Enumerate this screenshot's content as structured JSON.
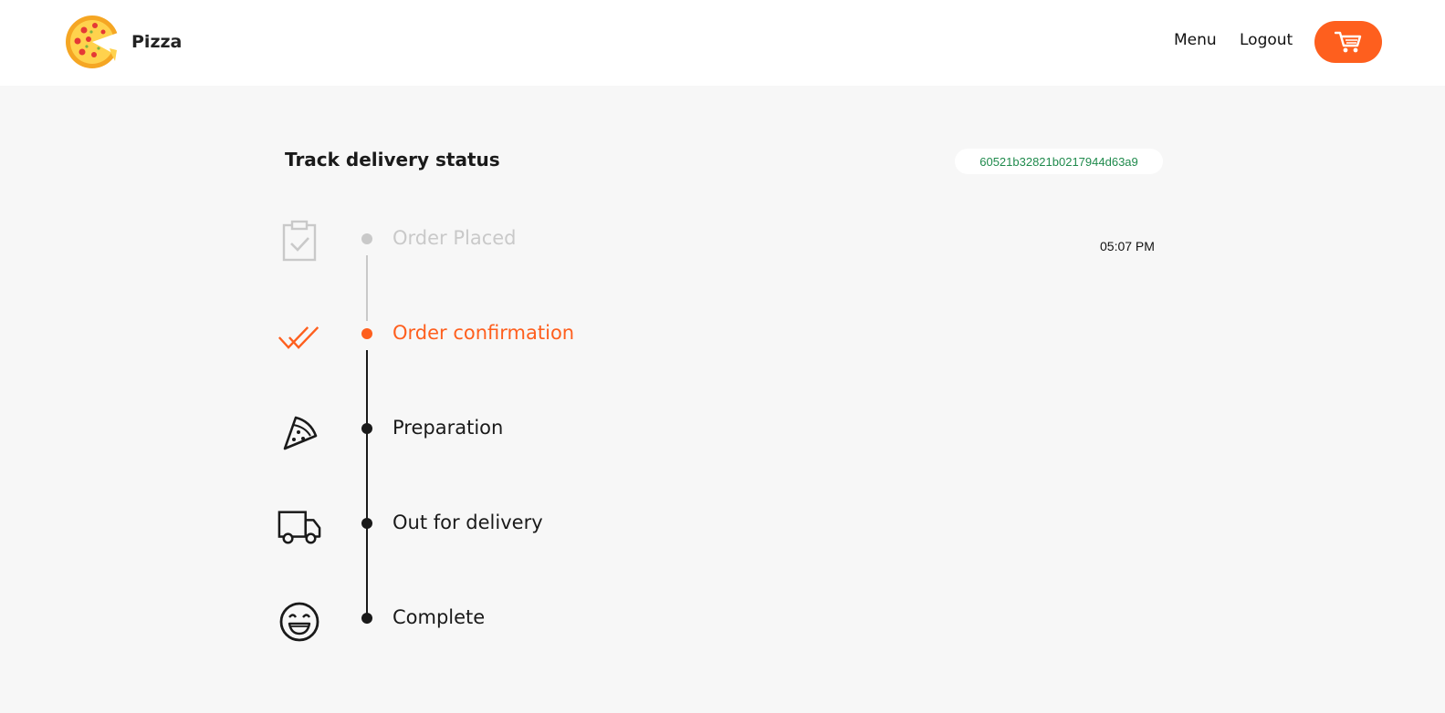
{
  "brand": {
    "name": "Pizza",
    "logo_icon": "pizza-logo-icon"
  },
  "nav": {
    "menu_label": "Menu",
    "logout_label": "Logout",
    "cart_icon": "cart-icon"
  },
  "colors": {
    "accent": "#fe5f1e",
    "done": "#c9c9c9",
    "order_id": "#1f8a4c",
    "background": "#f7f7f7"
  },
  "tracking": {
    "title": "Track delivery status",
    "order_id": "60521b32821b0217944d63a9",
    "steps": [
      {
        "label": "Order Placed",
        "state": "done",
        "time": "05:07 PM",
        "icon": "clipboard-check-icon"
      },
      {
        "label": "Order confirmation",
        "state": "current",
        "icon": "double-check-icon"
      },
      {
        "label": "Preparation",
        "state": "pending",
        "icon": "pizza-slice-icon"
      },
      {
        "label": "Out for delivery",
        "state": "pending",
        "icon": "delivery-truck-icon"
      },
      {
        "label": "Complete",
        "state": "pending",
        "icon": "smiley-face-icon"
      }
    ]
  }
}
